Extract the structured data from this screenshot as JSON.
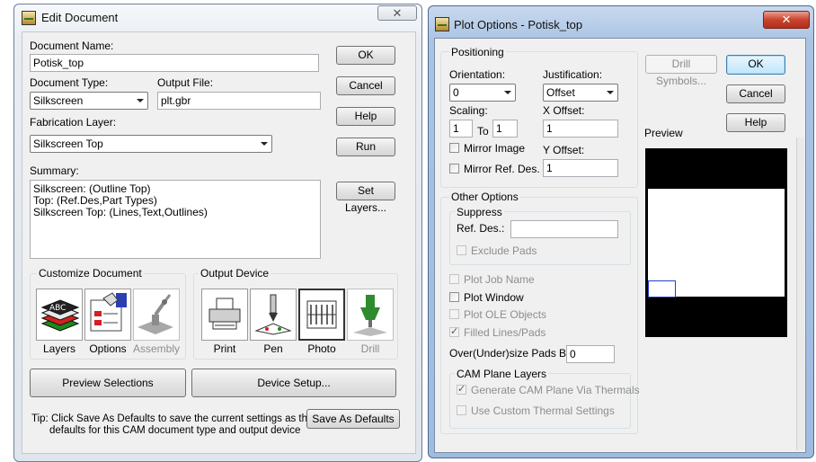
{
  "edit_document": {
    "title": "Edit Document",
    "close_glyph": "✕",
    "document_name_label": "Document Name:",
    "document_name_value": "Potisk_top",
    "document_type_label": "Document Type:",
    "document_type_value": "Silkscreen",
    "output_file_label": "Output File:",
    "output_file_value": "plt.gbr",
    "fabrication_layer_label": "Fabrication Layer:",
    "fabrication_layer_value": "Silkscreen Top",
    "summary_label": "Summary:",
    "summary_lines": [
      "Silkscreen: (Outline Top)",
      "Top: (Ref.Des,Part Types)",
      "Silkscreen Top: (Lines,Text,Outlines)"
    ],
    "buttons": {
      "ok": "OK",
      "cancel": "Cancel",
      "help": "Help",
      "run": "Run",
      "set_layers": "Set Layers...",
      "preview_selections": "Preview Selections",
      "device_setup": "Device Setup...",
      "save_as_defaults": "Save As Defaults"
    },
    "customize_document_label": "Customize Document",
    "customize_items": [
      {
        "label": "Layers",
        "icon": "layers-icon",
        "enabled": true
      },
      {
        "label": "Options",
        "icon": "options-icon",
        "enabled": true
      },
      {
        "label": "Assembly",
        "icon": "assembly-icon",
        "enabled": false
      }
    ],
    "output_device_label": "Output Device",
    "output_devices": [
      {
        "label": "Print",
        "icon": "printer-icon",
        "enabled": true,
        "selected": false
      },
      {
        "label": "Pen",
        "icon": "pen-plotter-icon",
        "enabled": true,
        "selected": false
      },
      {
        "label": "Photo",
        "icon": "photo-plotter-icon",
        "enabled": true,
        "selected": true
      },
      {
        "label": "Drill",
        "icon": "drill-icon",
        "enabled": false,
        "selected": false
      }
    ],
    "tip_line1": "Tip: Click Save As Defaults to save the current settings as the",
    "tip_line2": "defaults for this CAM document type and output device"
  },
  "plot_options": {
    "title": "Plot Options - Potisk_top",
    "close_glyph": "✕",
    "positioning_label": "Positioning",
    "orientation_label": "Orientation:",
    "orientation_value": "0",
    "justification_label": "Justification:",
    "justification_value": "Offset",
    "scaling_label": "Scaling:",
    "scaling_value": "1",
    "scaling_to_label": "To",
    "scaling_to_value": "1",
    "x_offset_label": "X Offset:",
    "x_offset_value": "1",
    "y_offset_label": "Y Offset:",
    "y_offset_value": "1",
    "mirror_image_label": "Mirror Image",
    "mirror_ref_des_label": "Mirror Ref. Des.",
    "other_options_label": "Other Options",
    "suppress_label": "Suppress",
    "ref_des_label": "Ref. Des.:",
    "ref_des_value": "",
    "exclude_pads_label": "Exclude Pads",
    "plot_job_name_label": "Plot Job Name",
    "plot_window_label": "Plot Window",
    "plot_ole_objects_label": "Plot OLE Objects",
    "filled_lines_pads_label": "Filled Lines/Pads",
    "oversize_pads_label": "Over(Under)size Pads By:",
    "oversize_pads_value": "0",
    "cam_plane_layers_label": "CAM Plane Layers",
    "generate_cam_plane_label": "Generate CAM Plane Via Thermals",
    "use_custom_thermal_label": "Use Custom Thermal Settings",
    "buttons": {
      "drill_symbols": "Drill Symbols...",
      "ok": "OK",
      "cancel": "Cancel",
      "help": "Help"
    },
    "preview_label": "Preview"
  }
}
